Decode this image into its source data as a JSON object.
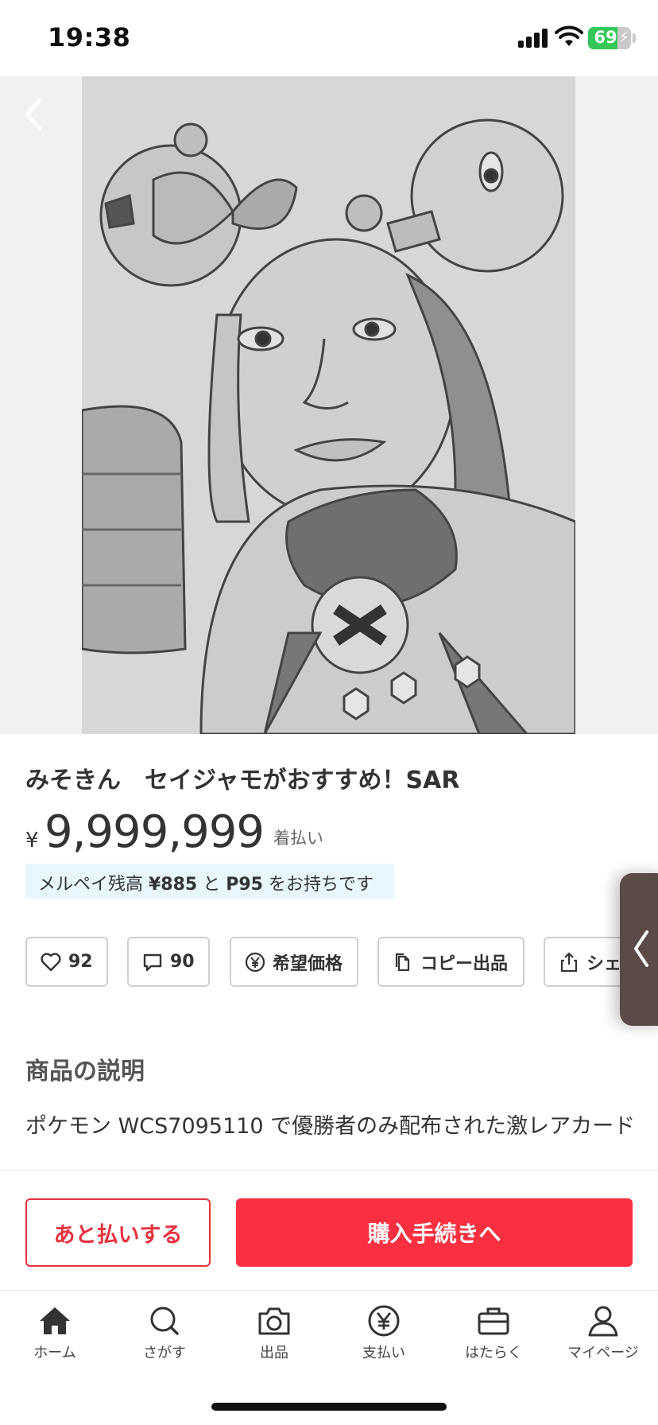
{
  "status_bar": {
    "time": "19:38",
    "battery": "69"
  },
  "item": {
    "title": "みそきん　セイジャモがおすすめ！SAR",
    "price_currency": "¥",
    "price": "9,999,999",
    "shipping": "着払い"
  },
  "merpay": {
    "prefix": "メルペイ残高 ",
    "balance": "¥885",
    "mid": " と ",
    "points": "P95",
    "suffix": " をお持ちです"
  },
  "actions": {
    "like_count": "92",
    "comment_count": "90",
    "offer_label": "希望価格",
    "copy_label": "コピー出品",
    "share_label": "シェア"
  },
  "description": {
    "heading": "商品の説明",
    "body": "ポケモン WCS7095110 で優勝者のみ配布された激レアカード"
  },
  "purchase": {
    "later_label": "あと払いする",
    "buy_label": "購入手続きへ"
  },
  "tabs": [
    {
      "label": "ホーム",
      "icon": "home-icon"
    },
    {
      "label": "さがす",
      "icon": "search-icon"
    },
    {
      "label": "出品",
      "icon": "camera-icon"
    },
    {
      "label": "支払い",
      "icon": "yen-icon"
    },
    {
      "label": "はたらく",
      "icon": "briefcase-icon"
    },
    {
      "label": "マイページ",
      "icon": "person-icon"
    }
  ],
  "colors": {
    "accent": "#fa3040",
    "merpay_bg": "#e8f6fd",
    "battery": "#35c759"
  }
}
